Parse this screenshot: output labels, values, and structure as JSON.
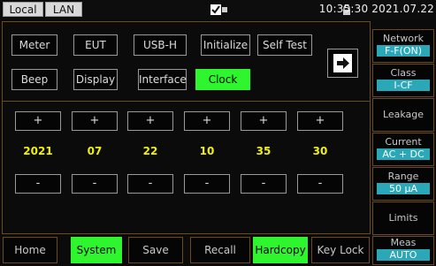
{
  "status": {
    "tab_local": "Local",
    "tab_lan": "LAN",
    "datetime": "10:35:30 2021.07.22",
    "icons": [
      "usb-icon",
      "lock-icon"
    ]
  },
  "menu": {
    "meter": "Meter",
    "eut": "EUT",
    "usb_h": "USB-H",
    "initialize": "Initialize",
    "self_test": "Self Test",
    "beep": "Beep",
    "display": "Display",
    "interface": "Interface",
    "clock": "Clock",
    "next_icon": "arrow-right-icon"
  },
  "clock_setting": {
    "plus": "+",
    "minus": "-",
    "values": [
      "2021",
      "07",
      "22",
      "10",
      "35",
      "30"
    ]
  },
  "side": {
    "network_label": "Network",
    "network_value": "F-F(ON)",
    "class_label": "Class",
    "class_value": "I-CF",
    "leakage_label": "Leakage",
    "current_label": "Current",
    "current_value": "AC + DC",
    "range_label": "Range",
    "range_value": "50 μA",
    "limits_label": "Limits",
    "meas_label": "Meas",
    "meas_value": "AUTO"
  },
  "bottom": {
    "home": "Home",
    "system": "System",
    "save": "Save",
    "recall": "Recall",
    "hardcopy": "Hardcopy",
    "key_lock": "Key Lock"
  },
  "colors": {
    "active_green": "#2ef52e",
    "value_yellow": "#f2f200",
    "value_cyan": "#2aa8b8",
    "frame_brown": "#6b4a1d"
  }
}
